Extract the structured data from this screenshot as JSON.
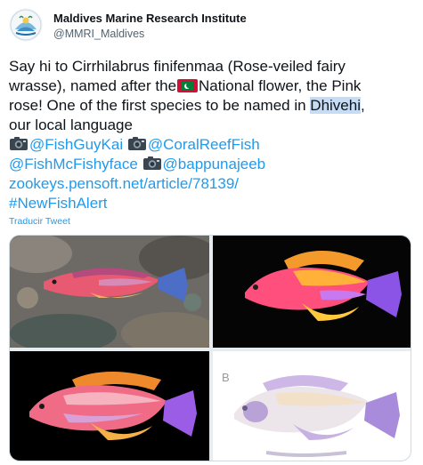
{
  "author": {
    "name": "Maldives Marine Research Institute",
    "handle": "@MMRI_Maldives"
  },
  "tweet": {
    "line1": "Say hi to Cirrhilabrus finifenmaa (Rose-veiled fairy",
    "line2_a": "wrasse), named after the",
    "line2_b": "National flower, the Pink",
    "line3_a": "rose! One of the first species to be named in ",
    "line3_highlight": "Dhivehi",
    "line3_b": ",",
    "line4": "our local language",
    "mention1": "@FishGuyKai",
    "mention2": "@CoralReefFish",
    "mention3": "@FishMcFishyface",
    "mention4": "@bappunajeeb",
    "url": "zookeys.pensoft.net/article/78139/",
    "hashtag": "#NewFishAlert"
  },
  "translate_label": "Traducir Tweet",
  "media": {
    "panel_label": "B"
  },
  "colors": {
    "link": "#1d9bf0",
    "highlight": "#c6dcf5",
    "text": "#0f1419",
    "secondary": "#536471"
  }
}
